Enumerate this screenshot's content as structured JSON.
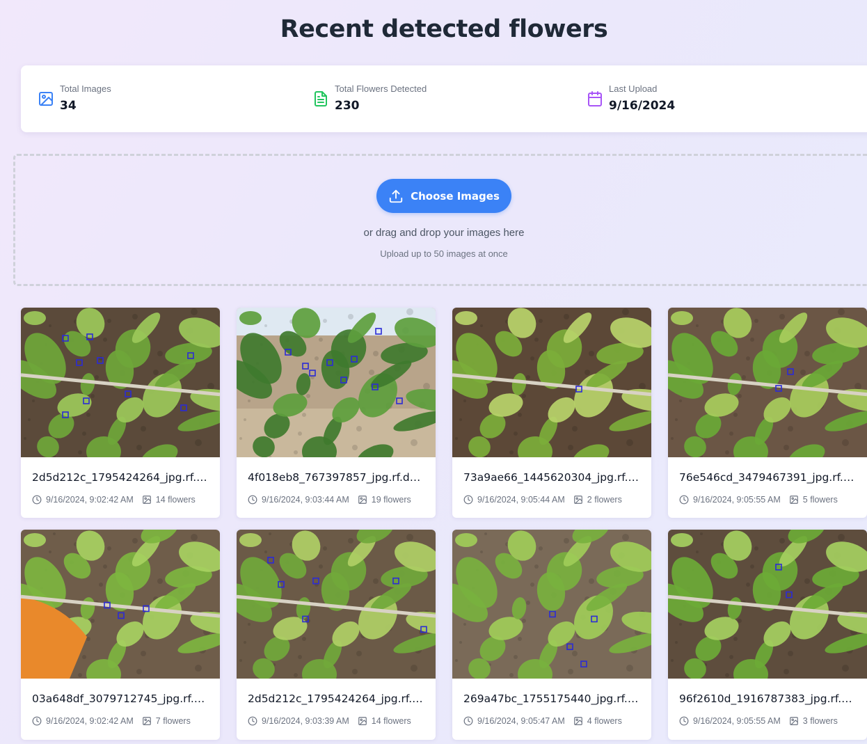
{
  "page": {
    "title": "Recent detected flowers"
  },
  "stats": [
    {
      "label": "Total Images",
      "value": "34",
      "icon": "image-icon",
      "color": "#3b82f6"
    },
    {
      "label": "Total Flowers Detected",
      "value": "230",
      "icon": "document-icon",
      "color": "#22c55e"
    },
    {
      "label": "Last Upload",
      "value": "9/16/2024",
      "icon": "calendar-icon",
      "color": "#a855f7"
    }
  ],
  "upload": {
    "button_label": "Choose Images",
    "button_icon": "upload-icon",
    "drag_text": "or drag and drop your images here",
    "limit_text": "Upload up to 50 images at once",
    "accent": "#3b82f6"
  },
  "images": [
    {
      "filename": "2d5d212c_1795424264_jpg.rf.…",
      "timestamp": "9/16/2024, 9:02:42 AM",
      "flowers": "14 flowers"
    },
    {
      "filename": "4f018eb8_767397857_jpg.rf.d…",
      "timestamp": "9/16/2024, 9:03:44 AM",
      "flowers": "19 flowers"
    },
    {
      "filename": "73a9ae66_1445620304_jpg.rf.…",
      "timestamp": "9/16/2024, 9:05:44 AM",
      "flowers": "2 flowers"
    },
    {
      "filename": "76e546cd_3479467391_jpg.rf.…",
      "timestamp": "9/16/2024, 9:05:55 AM",
      "flowers": "5 flowers"
    },
    {
      "filename": "03a648df_3079712745_jpg.rf.…",
      "timestamp": "9/16/2024, 9:02:42 AM",
      "flowers": "7 flowers"
    },
    {
      "filename": "2d5d212c_1795424264_jpg.rf.…",
      "timestamp": "9/16/2024, 9:03:39 AM",
      "flowers": "14 flowers"
    },
    {
      "filename": "269a47bc_1755175440_jpg.rf.…",
      "timestamp": "9/16/2024, 9:05:47 AM",
      "flowers": "4 flowers"
    },
    {
      "filename": "96f2610d_1916787383_jpg.rf.c…",
      "timestamp": "9/16/2024, 9:05:55 AM",
      "flowers": "3 flowers"
    }
  ]
}
